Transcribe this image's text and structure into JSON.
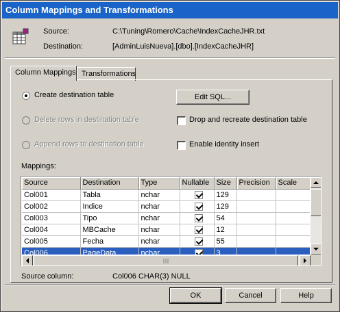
{
  "window": {
    "title": "Column Mappings and Transformations"
  },
  "header": {
    "source_label": "Source:",
    "source_value": "C:\\Tuning\\Romero\\Cache\\IndexCacheJHR.txt",
    "destination_label": "Destination:",
    "destination_value": "[AdminLuisNueva].[dbo].[IndexCacheJHR]",
    "icon": "table-grid-icon"
  },
  "tabs": [
    {
      "label": "Column Mappings",
      "active": true
    },
    {
      "label": "Transformations",
      "active": false
    }
  ],
  "options": {
    "create_table": {
      "label": "Create destination table",
      "checked": true,
      "enabled": true
    },
    "delete_rows": {
      "label": "Delete rows in destination table",
      "checked": false,
      "enabled": false
    },
    "append_rows": {
      "label": "Append rows to destination table",
      "checked": false,
      "enabled": false
    },
    "edit_sql_label": "Edit SQL...",
    "drop_recreate": {
      "label": "Drop and recreate destination table",
      "checked": false
    },
    "identity_insert": {
      "label": "Enable identity insert",
      "checked": false
    }
  },
  "mappings": {
    "label": "Mappings:",
    "columns": [
      "Source",
      "Destination",
      "Type",
      "Nullable",
      "Size",
      "Precision",
      "Scale"
    ],
    "rows": [
      {
        "source": "Col001",
        "destination": "Tabla",
        "type": "nchar",
        "nullable": true,
        "size": "129",
        "precision": "",
        "scale": ""
      },
      {
        "source": "Col002",
        "destination": "Indice",
        "type": "nchar",
        "nullable": true,
        "size": "129",
        "precision": "",
        "scale": ""
      },
      {
        "source": "Col003",
        "destination": "Tipo",
        "type": "nchar",
        "nullable": true,
        "size": "54",
        "precision": "",
        "scale": ""
      },
      {
        "source": "Col004",
        "destination": "MBCache",
        "type": "nchar",
        "nullable": true,
        "size": "12",
        "precision": "",
        "scale": ""
      },
      {
        "source": "Col005",
        "destination": "Fecha",
        "type": "nchar",
        "nullable": true,
        "size": "55",
        "precision": "",
        "scale": ""
      },
      {
        "source": "Col006",
        "destination": "PageData",
        "type": "nchar",
        "nullable": true,
        "size": "3",
        "precision": "",
        "scale": ""
      }
    ],
    "selected_row": 5
  },
  "status": {
    "source_column_label": "Source column:",
    "source_column_value": "Col006 CHAR(3) NULL"
  },
  "buttons": {
    "ok": "OK",
    "cancel": "Cancel",
    "help": "Help"
  },
  "colors": {
    "title_bar": "#1a63c8",
    "selection": "#2b5fbf",
    "face": "#d4d0c8"
  }
}
